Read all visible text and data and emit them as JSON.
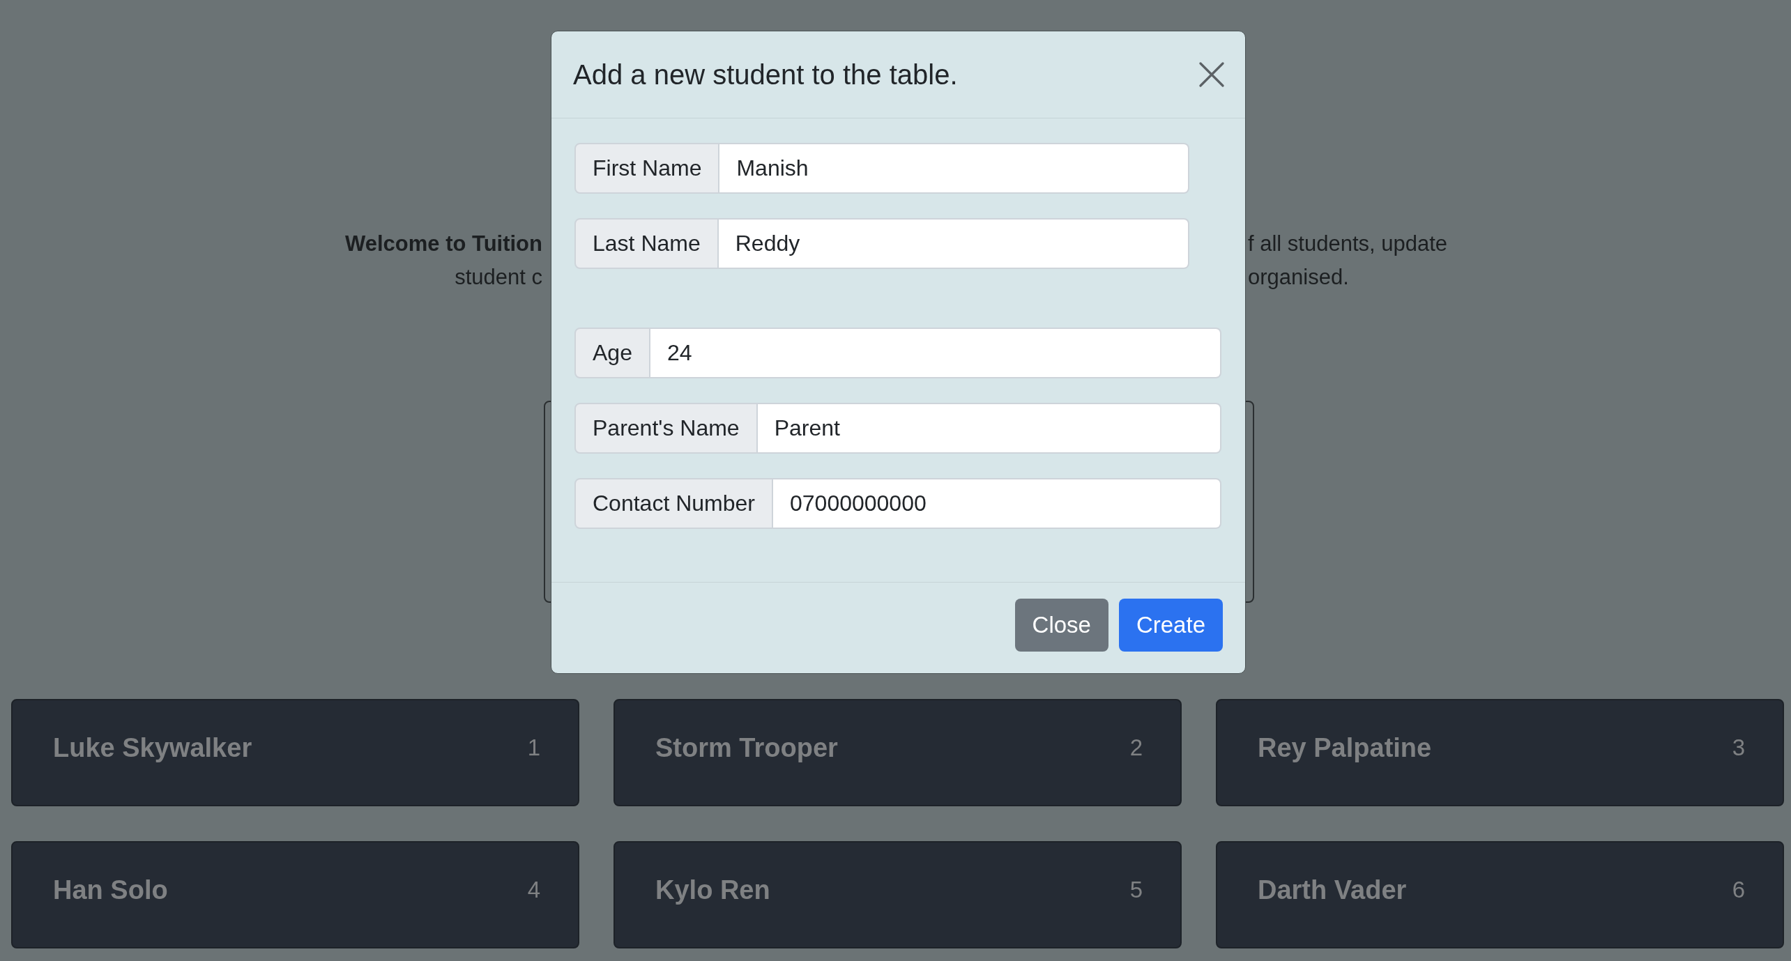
{
  "intro_text": {
    "left_lines": [
      "**Welcome to Tuition**",
      "student c"
    ],
    "right_lines": [
      "f all students, update",
      "organised."
    ]
  },
  "modal": {
    "title": "Add a new student to the table.",
    "groups": [
      {
        "fields": [
          {
            "label": "First Name",
            "value": "Manish"
          },
          {
            "label": "Last Name",
            "value": "Reddy"
          }
        ]
      },
      {
        "fields": [
          {
            "label": "Age",
            "value": "24"
          },
          {
            "label": "Parent's Name",
            "value": "Parent"
          },
          {
            "label": "Contact Number",
            "value": "07000000000"
          }
        ]
      }
    ],
    "buttons": [
      {
        "label": "Close",
        "kind": "secondary"
      },
      {
        "label": "Create",
        "kind": "primary"
      }
    ]
  },
  "students": [
    {
      "name": "Luke Skywalker",
      "number": "1"
    },
    {
      "name": "Storm Trooper",
      "number": "2"
    },
    {
      "name": "Rey Palpatine",
      "number": "3"
    },
    {
      "name": "Han Solo",
      "number": "4"
    },
    {
      "name": "Kylo Ren",
      "number": "5"
    },
    {
      "name": "Darth Vader",
      "number": "6"
    }
  ]
}
